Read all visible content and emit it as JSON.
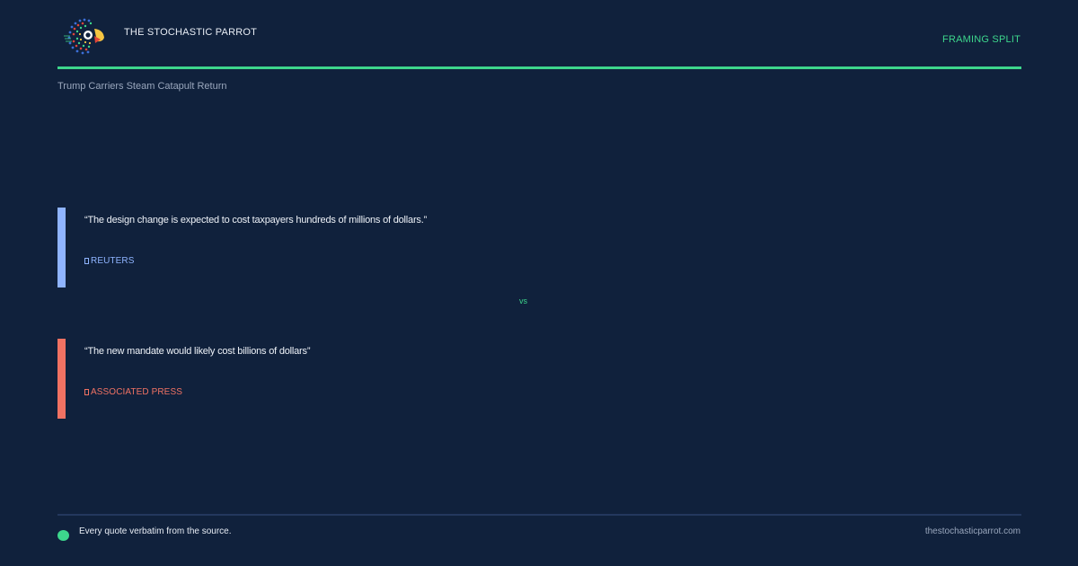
{
  "header": {
    "brand": "THE STOCHASTIC PARROT",
    "tag": "FRAMING SPLIT",
    "logo_icon": "parrot-logo-icon"
  },
  "headline": "Trump Carriers Steam Catapult Return",
  "quotes": [
    {
      "text": "“The design change is expected to cost taxpayers hundreds of millions of dollars.”",
      "source": "REUTERS",
      "color": "#8fb4ff"
    },
    {
      "text": "“The new mandate would likely cost billions of dollars”",
      "source": "ASSOCIATED PRESS",
      "color": "#f07263"
    }
  ],
  "vs_label": "vs",
  "footer": {
    "note": "Every quote verbatim from the source.",
    "url": "thestochasticparrot.com"
  },
  "colors": {
    "background": "#10213c",
    "accent": "#3dd68c"
  }
}
